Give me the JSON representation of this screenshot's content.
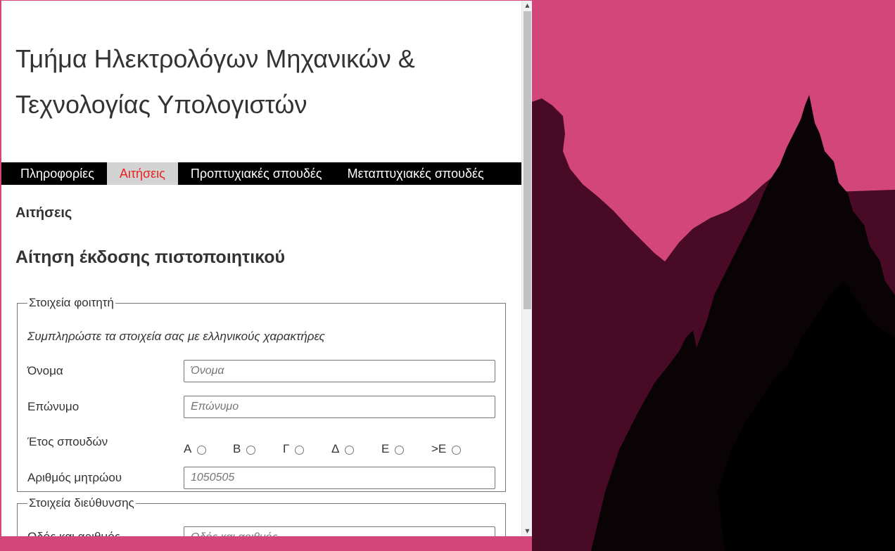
{
  "site": {
    "title_line1": "Τμήμα Ηλεκτρολόγων Μηχανικών &",
    "title_line2": "Τεχνολογίας Υπολογιστών"
  },
  "nav": {
    "items": [
      {
        "label": "Πληροφορίες",
        "active": false
      },
      {
        "label": "Αιτήσεις",
        "active": true
      },
      {
        "label": "Προπτυχιακές σπουδές",
        "active": false
      },
      {
        "label": "Μεταπτυχιακές σπουδές",
        "active": false
      }
    ]
  },
  "main": {
    "section_label": "Αιτήσεις",
    "form_title": "Αίτηση έκδοσης πιστοποιητικού"
  },
  "student": {
    "legend": "Στοιχεία φοιτητή",
    "hint": "Συμπληρώστε τα στοιχεία σας με ελληνικούς χαρακτήρες",
    "first_name": {
      "label": "Όνομα",
      "placeholder": "Όνομα"
    },
    "last_name": {
      "label": "Επώνυμο",
      "placeholder": "Επώνυμο"
    },
    "year": {
      "label": "Έτος σπουδών",
      "options": [
        "Α",
        "Β",
        "Γ",
        "Δ",
        "Ε",
        ">Ε"
      ]
    },
    "registration": {
      "label": "Αριθμός μητρώου",
      "placeholder": "1050505"
    }
  },
  "address": {
    "legend": "Στοιχεία διεύθυνσης",
    "street": {
      "label": "Οδός και αριθμός",
      "placeholder": "Οδός και αριθμός"
    }
  },
  "colors": {
    "sky": "#d24679",
    "nav_bg": "#000000",
    "nav_active_bg": "#d3d3d3",
    "nav_active_text": "#e8211d"
  },
  "icons": {
    "scroll_up": "triangle-up",
    "scroll_down": "triangle-down"
  }
}
